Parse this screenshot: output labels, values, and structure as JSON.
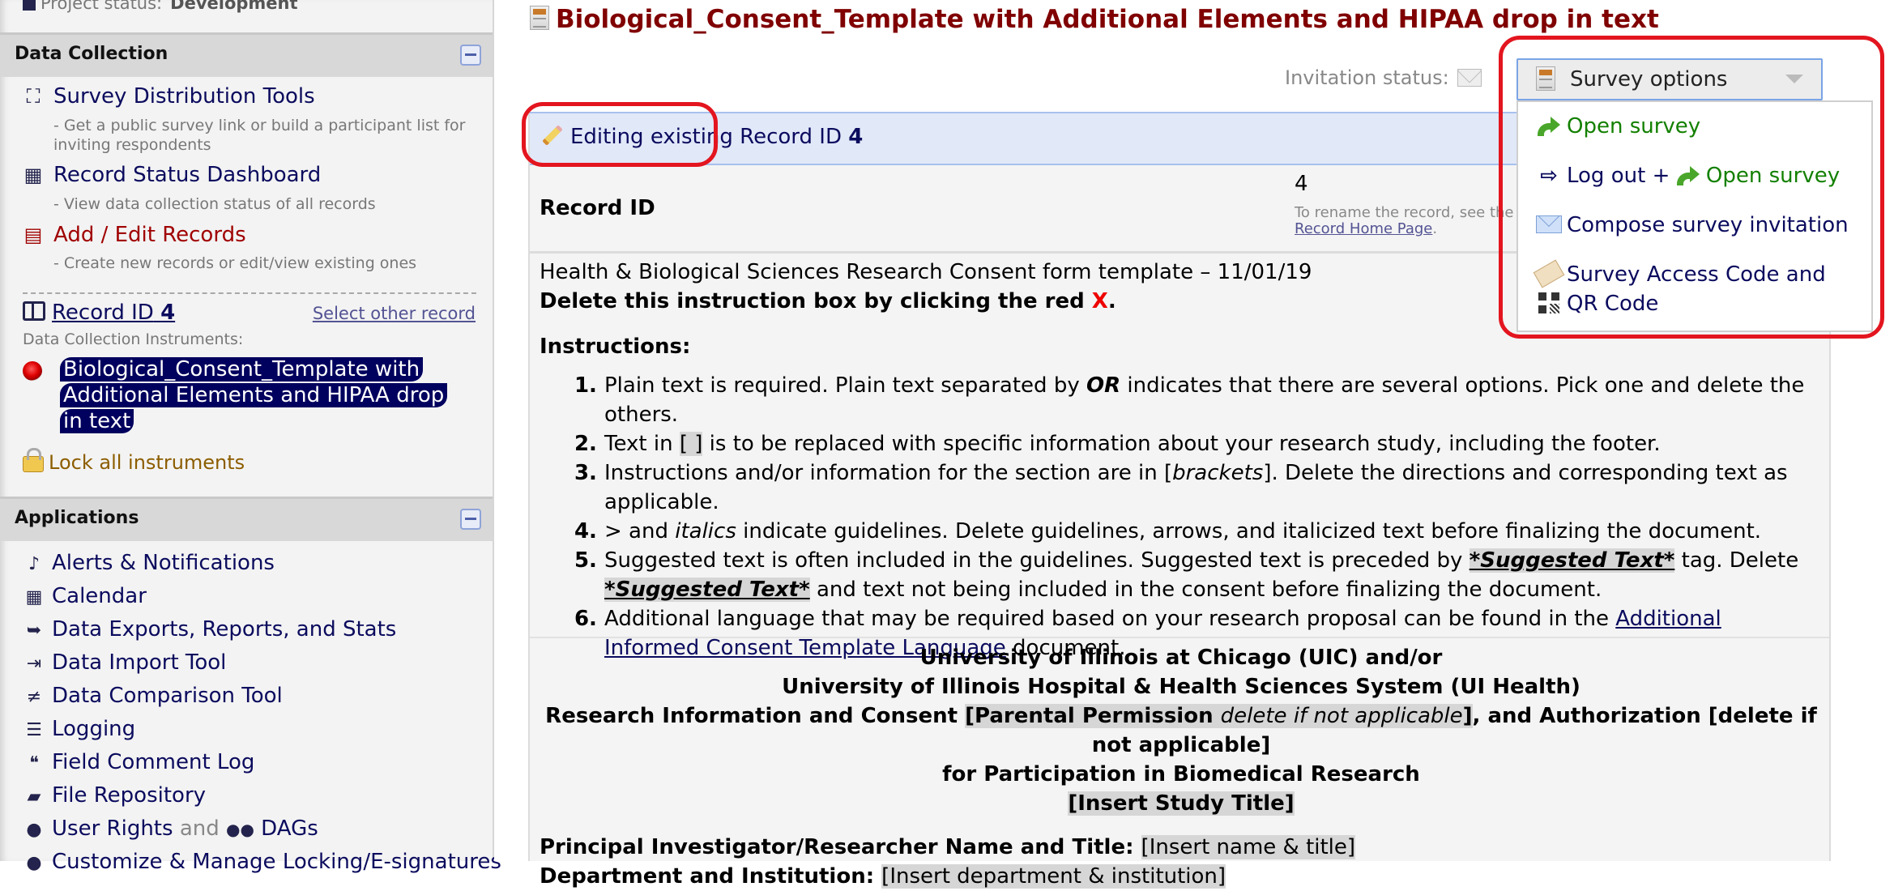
{
  "sidebar": {
    "project_status_label": "Project status:",
    "project_status_value": "Development",
    "data_collection": {
      "title": "Data Collection",
      "items": [
        {
          "label": "Survey Distribution Tools",
          "desc": "- Get a public survey link or build a participant list for inviting respondents",
          "icon": "survey-distribution-icon"
        },
        {
          "label": "Record Status Dashboard",
          "desc": "- View data collection status of all records",
          "icon": "grid-icon"
        },
        {
          "label": "Add / Edit Records",
          "desc": "- Create new records or edit/view existing ones",
          "icon": "file-icon"
        }
      ],
      "record_label": "Record ID",
      "record_id": "4",
      "select_other": "Select other record",
      "instruments_label": "Data Collection Instruments:",
      "instrument_name": "Biological_Consent_Template with Additional Elements and HIPAA drop in text",
      "instrument_status_color": "#d00000",
      "lock_all": "Lock all instruments"
    },
    "applications": {
      "title": "Applications",
      "items": [
        {
          "label": "Alerts & Notifications",
          "icon": "bell-icon",
          "glyph": "🔔"
        },
        {
          "label": "Calendar",
          "icon": "calendar-icon",
          "glyph": "▦"
        },
        {
          "label": "Data Exports, Reports, and Stats",
          "icon": "file-export-icon",
          "glyph": "⇨"
        },
        {
          "label": "Data Import Tool",
          "icon": "file-import-icon",
          "glyph": "⇥"
        },
        {
          "label": "Data Comparison Tool",
          "icon": "not-equal-icon",
          "glyph": "≠"
        },
        {
          "label": "Logging",
          "icon": "receipt-icon",
          "glyph": "☰"
        },
        {
          "label": "Field Comment Log",
          "icon": "comments-icon",
          "glyph": "💬"
        },
        {
          "label": "File Repository",
          "icon": "folder-open-icon",
          "glyph": "📂"
        },
        {
          "label": "User Rights",
          "and": "and",
          "label2": "DAGs",
          "icon": "user-icon",
          "glyph": "👤",
          "glyph2": "👥"
        },
        {
          "label": "Customize & Manage Locking/E-signatures",
          "icon": "user-lock-icon",
          "glyph": "👤"
        }
      ]
    }
  },
  "main": {
    "form_title": "Biological_Consent_Template with Additional Elements and HIPAA drop in text",
    "invitation_status_label": "Invitation status:",
    "editing_label": "Editing existing Record ID",
    "editing_record_id": "4",
    "record_id_field": {
      "label": "Record ID",
      "value": "4",
      "hint": "To rename the record, see the re",
      "hint_link": "Record Home Page",
      "hint_end": "."
    },
    "description": {
      "line1": "Health & Biological Sciences Research Consent form template – 11/01/19",
      "line2_pre": "Delete this instruction box by clicking the red ",
      "line2_x": "X",
      "line2_end": ".",
      "instructions_heading": "Instructions:",
      "items": {
        "i1_a": "Plain text is required. Plain text separated by ",
        "i1_or": "OR",
        "i1_b": " indicates that there are several options. Pick one and delete the others.",
        "i2_a": "Text in ",
        "i2_br": "[ ]",
        "i2_b": " is to be replaced with specific information about your research study, including the footer.",
        "i3_a": "Instructions and/or information for the section are in [",
        "i3_it": "brackets",
        "i3_b": "]. Delete the directions and corresponding text as applicable.",
        "i4_a": "> and ",
        "i4_it": "italics",
        "i4_b": " indicate guidelines. Delete guidelines, arrows, and italicized text before finalizing the document.",
        "i5_a": "Suggested text is often included in the guidelines. Suggested text is preceded by ",
        "i5_tag": "*Suggested Text*",
        "i5_b": " tag. Delete ",
        "i5_tag2": "*Suggested Text*",
        "i5_c": " and text not being included in the consent before finalizing the document.",
        "i6_a": "Additional language that may be required based on your research proposal can be found in the ",
        "i6_link": "Additional Informed Consent Template Language",
        "i6_b": " document."
      }
    },
    "consent": {
      "h1": "University of Illinois at Chicago (UIC) and/or",
      "h2": "University of Illinois Hospital & Health Sciences System (UI Health)",
      "h3_a": "Research Information and Consent ",
      "h3_hl": "[Parental Permission ",
      "h3_it": "delete if not applicable",
      "h3_hl_end": "]",
      "h3_b": ", and Authorization [delete if not applicable]",
      "h4": "for Participation in Biomedical Research",
      "h5": "[Insert Study Title]",
      "pi_label": "Principal Investigator/Researcher Name and Title:",
      "pi_value": "[Insert name & title]",
      "dept_label": "Department and Institution:",
      "dept_value": "[Insert department & institution]"
    },
    "survey_options": {
      "button_label": "Survey options",
      "menu": {
        "open_survey": "Open survey",
        "logout": "Log out",
        "plus": "+",
        "logout_open_survey": "Open survey",
        "compose": "Compose survey invitation",
        "access_code_line1": "Survey Access Code and",
        "access_code_line2": "QR Code"
      }
    }
  },
  "colors": {
    "title": "#800000",
    "link": "#0b0b5e",
    "green": "#138000",
    "annotation": "#e3151f",
    "edit_bar": "#e1e8f8",
    "instrument_highlight": "#00005e"
  }
}
